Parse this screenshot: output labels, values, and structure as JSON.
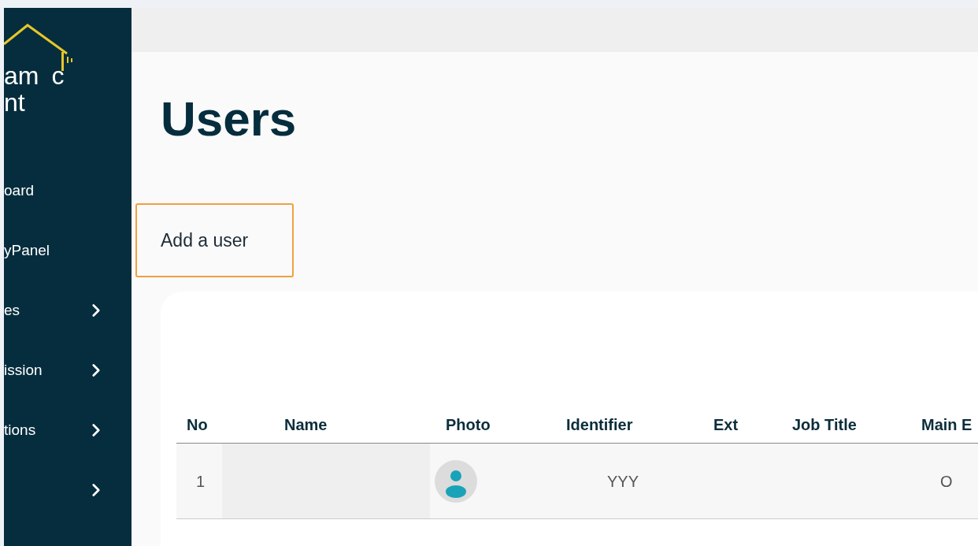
{
  "logo": {
    "line1_start": "am",
    "line1_end": "c",
    "line2": "nt"
  },
  "sidebar": {
    "items": [
      {
        "label": "oard",
        "expandable": false
      },
      {
        "label": "yPanel",
        "expandable": false
      },
      {
        "label": "es",
        "expandable": true
      },
      {
        "label": "ission",
        "expandable": true
      },
      {
        "label": "tions",
        "expandable": true
      },
      {
        "expandable": true
      }
    ]
  },
  "page_title": "Users",
  "add_button": "Add a user",
  "table": {
    "columns": [
      "No",
      "Name",
      "Photo",
      "Identifier",
      "Ext",
      "Job Title",
      "Main E"
    ],
    "rows": [
      {
        "no": "1",
        "identifier": "YYY",
        "column_7": "O"
      }
    ]
  }
}
